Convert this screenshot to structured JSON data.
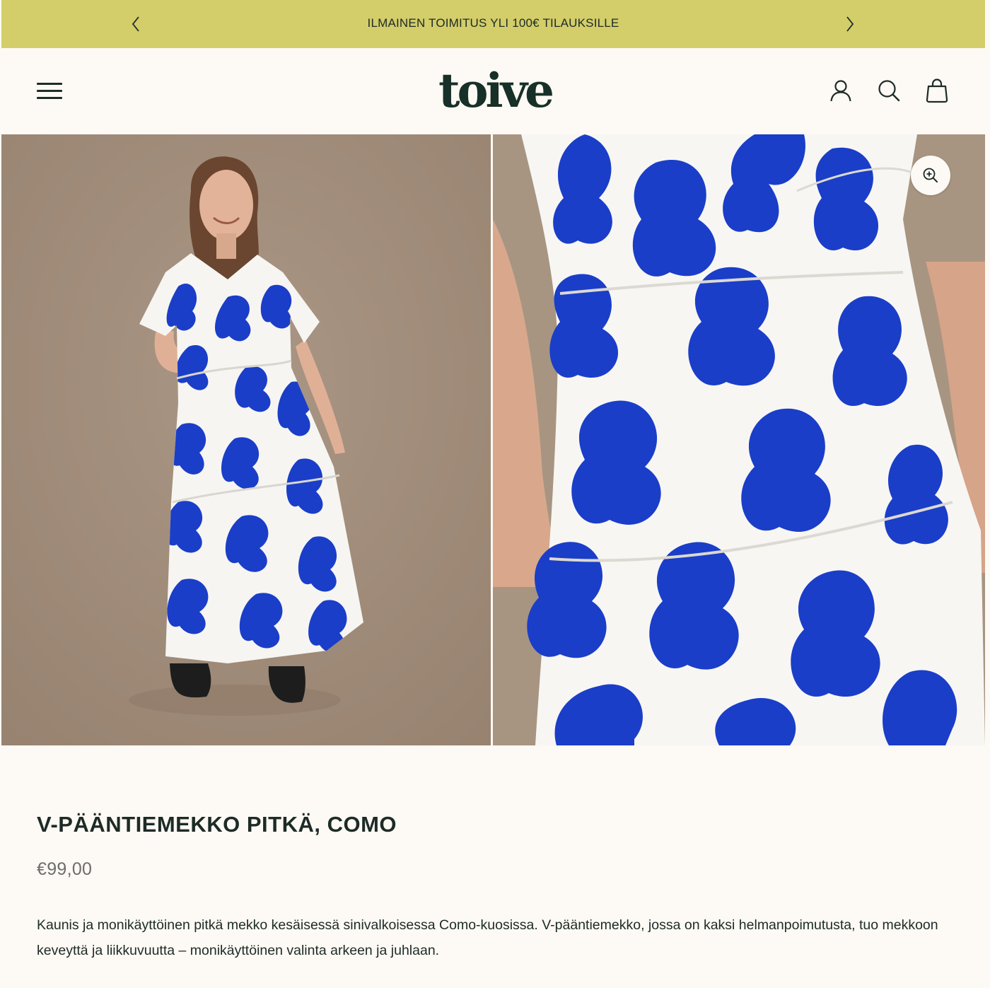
{
  "announcement": {
    "text": "ILMAINEN TOIMITUS YLI 100€ TILAUKSILLE",
    "prev_icon": "chevron-left-icon",
    "next_icon": "chevron-right-icon"
  },
  "header": {
    "logo_text": "toive",
    "menu_icon": "hamburger-menu-icon",
    "account_icon": "user-icon",
    "search_icon": "search-icon",
    "cart_icon": "shopping-bag-icon"
  },
  "gallery": {
    "images": [
      {
        "name": "full-length-model-photo"
      },
      {
        "name": "dress-detail-photo"
      }
    ],
    "zoom_icon": "zoom-in-icon"
  },
  "product": {
    "title": "V-PÄÄNTIEMEKKO PITKÄ, COMO",
    "price": "€99,00",
    "description": "Kaunis ja monikäyttöinen pitkä mekko kesäisessä sinivalkoisessa Como-kuosissa. V-pääntiemekko, jossa on kaksi helmanpoimutusta, tuo mekkoon keveyttä ja liikkuvuutta – monikäyttöinen valinta arkeen ja juhlaan."
  },
  "colors": {
    "announcement_bg": "#d3cd6a",
    "page_bg": "#fdf9f4",
    "text": "#1d2b27",
    "price": "#6d6d6d",
    "pattern_blue": "#1a3ec8",
    "photo_bg": "#a18d7b"
  }
}
